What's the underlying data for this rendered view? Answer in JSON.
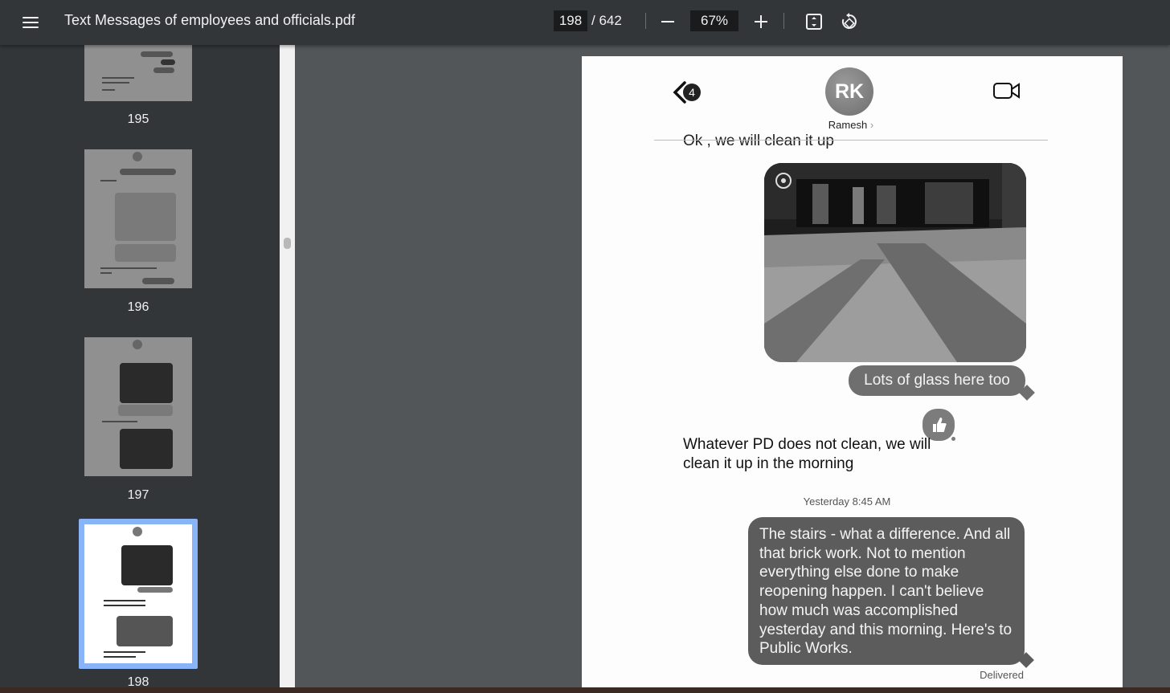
{
  "toolbar": {
    "title": "Text Messages of employees and officials.pdf",
    "page_current": "198",
    "page_total": "/ 642",
    "zoom": "67%"
  },
  "sidebar": {
    "thumbnails": [
      {
        "page": "195"
      },
      {
        "page": "196"
      },
      {
        "page": "197"
      },
      {
        "page": "198",
        "selected": true
      }
    ]
  },
  "conversation": {
    "back_badge": "4",
    "avatar_initials": "RK",
    "contact_name": "Ramesh",
    "cut_off_text": "Ok , we will clean it up",
    "sent_1": "Lots of glass here too",
    "received_1": "Whatever PD does not clean, we will clean it up in the morning",
    "timestamp": "Yesterday 8:45 AM",
    "sent_2": "The stairs - what a difference. And all that brick work. Not to mention everything else done to make reopening happen. I can't believe how much was accomplished yesterday and this morning. Here's to Public Works.",
    "delivered": "Delivered"
  },
  "colors": {
    "toolbar_bg": "#323639",
    "viewer_bg": "#525659",
    "selected_thumb_border": "#8ab4f8"
  }
}
